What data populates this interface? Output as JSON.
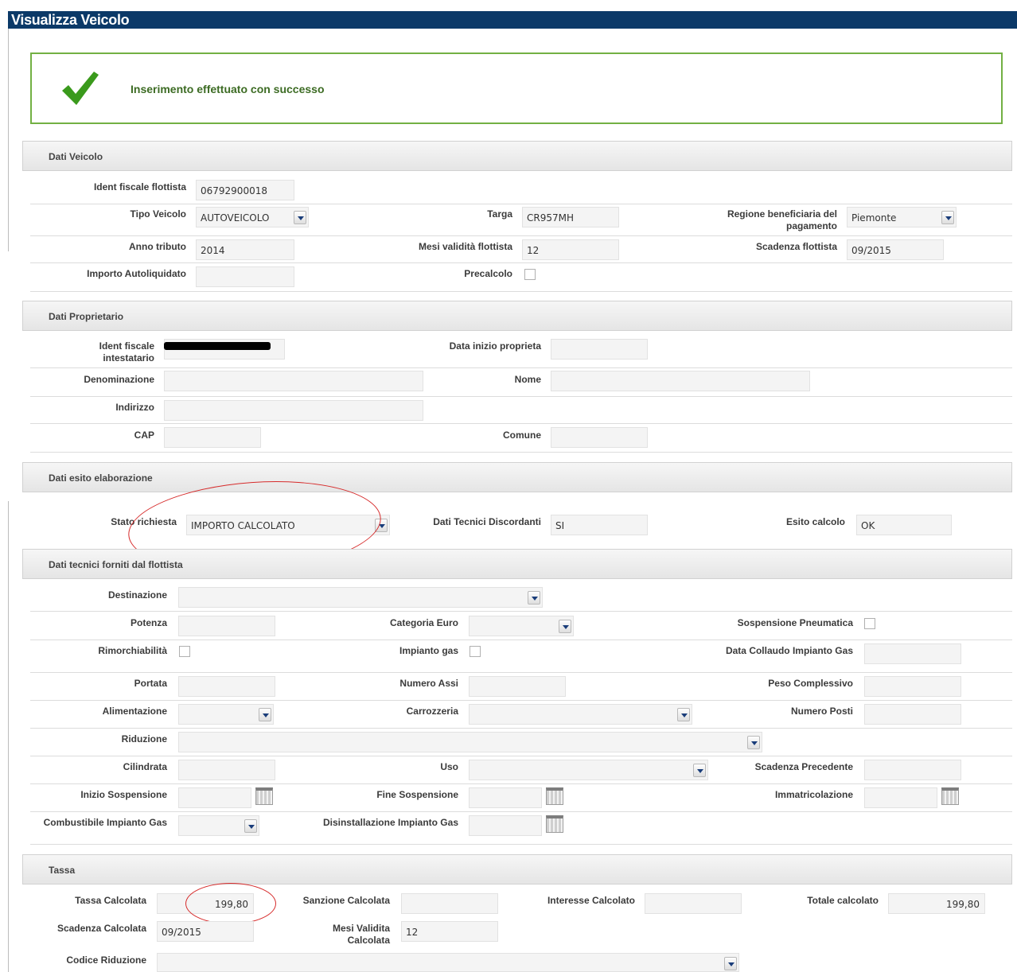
{
  "page": {
    "title": "Visualizza Veicolo"
  },
  "success": {
    "message": "Inserimento effettuato con successo"
  },
  "sections": {
    "veicolo": "Dati Veicolo",
    "proprietario": "Dati Proprietario",
    "esito": "Dati esito elaborazione",
    "tecnici": "Dati tecnici forniti dal flottista",
    "tassa": "Tassa"
  },
  "veicolo": {
    "ident_label": "Ident fiscale flottista",
    "ident_value": "06792900018",
    "tipo_label": "Tipo Veicolo",
    "tipo_value": "AUTOVEICOLO",
    "targa_label": "Targa",
    "targa_value": "CR957MH",
    "regione_label": "Regione beneficiaria del pagamento",
    "regione_value": "Piemonte",
    "anno_label": "Anno tributo",
    "anno_value": "2014",
    "mesi_label": "Mesi validità flottista",
    "mesi_value": "12",
    "scadenza_label": "Scadenza flottista",
    "scadenza_value": "09/2015",
    "importo_label": "Importo Autoliquidato",
    "importo_value": "",
    "precalcolo_label": "Precalcolo"
  },
  "proprietario": {
    "ident_label": "Ident fiscale intestatario",
    "data_label": "Data inizio proprieta",
    "denominazione_label": "Denominazione",
    "nome_label": "Nome",
    "indirizzo_label": "Indirizzo",
    "cap_label": "CAP",
    "comune_label": "Comune"
  },
  "esito": {
    "stato_label": "Stato richiesta",
    "stato_value": "IMPORTO CALCOLATO",
    "discordanti_label": "Dati Tecnici Discordanti",
    "discordanti_value": "SI",
    "esito_label": "Esito calcolo",
    "esito_value": "OK"
  },
  "tecnici": {
    "destinazione": "Destinazione",
    "potenza": "Potenza",
    "categoria_euro": "Categoria Euro",
    "sospensione_pneumatica": "Sospensione Pneumatica",
    "rimorchiabilita": "Rimorchiabilità",
    "impianto_gas": "Impianto gas",
    "data_collaudo": "Data Collaudo Impianto Gas",
    "portata": "Portata",
    "numero_assi": "Numero Assi",
    "peso_complessivo": "Peso Complessivo",
    "alimentazione": "Alimentazione",
    "carrozzeria": "Carrozzeria",
    "numero_posti": "Numero Posti",
    "riduzione": "Riduzione",
    "cilindrata": "Cilindrata",
    "uso": "Uso",
    "scadenza_precedente": "Scadenza Precedente",
    "inizio_sospensione": "Inizio Sospensione",
    "fine_sospensione": "Fine Sospensione",
    "immatricolazione": "Immatricolazione",
    "combustibile": "Combustibile Impianto Gas",
    "disinstallazione": "Disinstallazione Impianto Gas"
  },
  "tassa": {
    "tassa_label": "Tassa Calcolata",
    "tassa_value": "199,80",
    "sanzione_label": "Sanzione Calcolata",
    "interesse_label": "Interesse Calcolato",
    "totale_label": "Totale calcolato",
    "totale_value": "199,80",
    "scadenza_label": "Scadenza Calcolata",
    "scadenza_value": "09/2015",
    "mesi_label": "Mesi Validita Calcolata",
    "mesi_value": "12",
    "codice_label": "Codice Riduzione"
  }
}
